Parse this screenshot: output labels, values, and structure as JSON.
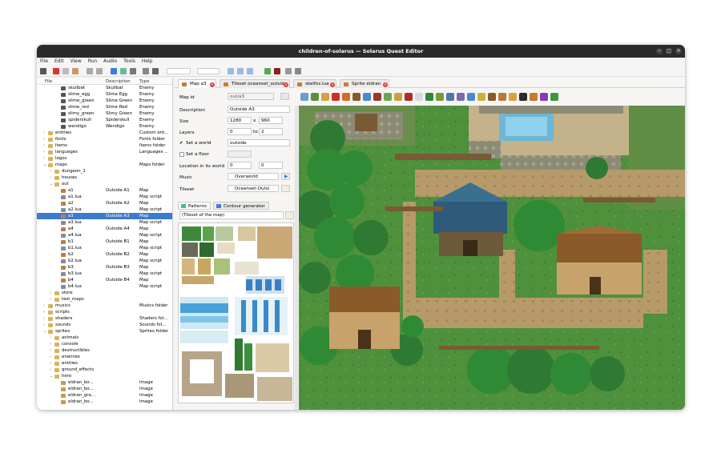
{
  "window": {
    "title": "children-of-solarus — Solarus Quest Editor"
  },
  "menu": [
    "File",
    "Edit",
    "View",
    "Run",
    "Audio",
    "Tools",
    "Help"
  ],
  "tree": {
    "headers": {
      "file": "File",
      "description": "Description",
      "type": "Type"
    },
    "rows": [
      {
        "name": "skullbat",
        "desc": "Skullbat",
        "type": "Enemy",
        "depth": 3,
        "kind": "sprite"
      },
      {
        "name": "slime_egg",
        "desc": "Slime Egg",
        "type": "Enemy",
        "depth": 3,
        "kind": "sprite"
      },
      {
        "name": "slime_green",
        "desc": "Slime Green",
        "type": "Enemy",
        "depth": 3,
        "kind": "sprite"
      },
      {
        "name": "slime_red",
        "desc": "Slime Red",
        "type": "Enemy",
        "depth": 3,
        "kind": "sprite"
      },
      {
        "name": "slimy_green",
        "desc": "Slimy Green",
        "type": "Enemy",
        "depth": 3,
        "kind": "sprite"
      },
      {
        "name": "spiderskull",
        "desc": "Spiderskull",
        "type": "Enemy",
        "depth": 3,
        "kind": "sprite"
      },
      {
        "name": "wendigo",
        "desc": "Wendigo",
        "type": "Enemy",
        "depth": 3,
        "kind": "sprite"
      },
      {
        "name": "entities",
        "desc": "",
        "type": "Custom ent...",
        "depth": 1,
        "kind": "folder",
        "arrow": "›"
      },
      {
        "name": "fonts",
        "desc": "",
        "type": "Fonts folder",
        "depth": 1,
        "kind": "folder",
        "arrow": "›"
      },
      {
        "name": "items",
        "desc": "",
        "type": "Items folder",
        "depth": 1,
        "kind": "folder",
        "arrow": "›"
      },
      {
        "name": "languages",
        "desc": "",
        "type": "Languages ...",
        "depth": 1,
        "kind": "folder",
        "arrow": "›"
      },
      {
        "name": "logos",
        "desc": "",
        "type": "",
        "depth": 1,
        "kind": "folder",
        "arrow": "›"
      },
      {
        "name": "maps",
        "desc": "",
        "type": "Maps folder",
        "depth": 1,
        "kind": "folder",
        "arrow": "⌄"
      },
      {
        "name": "dungeon_1",
        "desc": "",
        "type": "",
        "depth": 2,
        "kind": "folder",
        "arrow": "›"
      },
      {
        "name": "houses",
        "desc": "",
        "type": "",
        "depth": 2,
        "kind": "folder",
        "arrow": "›"
      },
      {
        "name": "out",
        "desc": "",
        "type": "",
        "depth": 2,
        "kind": "folder",
        "arrow": "⌄"
      },
      {
        "name": "a1",
        "desc": "Outside A1",
        "type": "Map",
        "depth": 3,
        "kind": "map"
      },
      {
        "name": "a1.lua",
        "desc": "",
        "type": "Map script",
        "depth": 3,
        "kind": "lua"
      },
      {
        "name": "a2",
        "desc": "Outside A2",
        "type": "Map",
        "depth": 3,
        "kind": "map"
      },
      {
        "name": "a2.lua",
        "desc": "",
        "type": "Map script",
        "depth": 3,
        "kind": "lua"
      },
      {
        "name": "a3",
        "desc": "Outside A3",
        "type": "Map",
        "depth": 3,
        "kind": "map",
        "sel": true
      },
      {
        "name": "a3.lua",
        "desc": "",
        "type": "Map script",
        "depth": 3,
        "kind": "lua"
      },
      {
        "name": "a4",
        "desc": "Outside A4",
        "type": "Map",
        "depth": 3,
        "kind": "map"
      },
      {
        "name": "a4.lua",
        "desc": "",
        "type": "Map script",
        "depth": 3,
        "kind": "lua"
      },
      {
        "name": "b1",
        "desc": "Outside B1",
        "type": "Map",
        "depth": 3,
        "kind": "map"
      },
      {
        "name": "b1.lua",
        "desc": "",
        "type": "Map script",
        "depth": 3,
        "kind": "lua"
      },
      {
        "name": "b2",
        "desc": "Outside B2",
        "type": "Map",
        "depth": 3,
        "kind": "map"
      },
      {
        "name": "b2.lua",
        "desc": "",
        "type": "Map script",
        "depth": 3,
        "kind": "lua"
      },
      {
        "name": "b3",
        "desc": "Outside B3",
        "type": "Map",
        "depth": 3,
        "kind": "map"
      },
      {
        "name": "b3.lua",
        "desc": "",
        "type": "Map script",
        "depth": 3,
        "kind": "lua"
      },
      {
        "name": "b4",
        "desc": "Outside B4",
        "type": "Map",
        "depth": 3,
        "kind": "map"
      },
      {
        "name": "b4.lua",
        "desc": "",
        "type": "Map script",
        "depth": 3,
        "kind": "lua"
      },
      {
        "name": "store",
        "desc": "",
        "type": "",
        "depth": 2,
        "kind": "folder",
        "arrow": "›"
      },
      {
        "name": "test_maps",
        "desc": "",
        "type": "",
        "depth": 2,
        "kind": "folder",
        "arrow": "›"
      },
      {
        "name": "musics",
        "desc": "",
        "type": "Musics folder",
        "depth": 1,
        "kind": "folder",
        "arrow": "›"
      },
      {
        "name": "scripts",
        "desc": "",
        "type": "",
        "depth": 1,
        "kind": "folder",
        "arrow": "›"
      },
      {
        "name": "shaders",
        "desc": "",
        "type": "Shaders fol...",
        "depth": 1,
        "kind": "folder",
        "arrow": "›"
      },
      {
        "name": "sounds",
        "desc": "",
        "type": "Sounds fol...",
        "depth": 1,
        "kind": "folder",
        "arrow": "›"
      },
      {
        "name": "sprites",
        "desc": "",
        "type": "Sprites folder",
        "depth": 1,
        "kind": "folder",
        "arrow": "⌄"
      },
      {
        "name": "animals",
        "desc": "",
        "type": "",
        "depth": 2,
        "kind": "folder",
        "arrow": "›"
      },
      {
        "name": "console",
        "desc": "",
        "type": "",
        "depth": 2,
        "kind": "folder",
        "arrow": "›"
      },
      {
        "name": "destructibles",
        "desc": "",
        "type": "",
        "depth": 2,
        "kind": "folder",
        "arrow": "›"
      },
      {
        "name": "enemies",
        "desc": "",
        "type": "",
        "depth": 2,
        "kind": "folder",
        "arrow": "›"
      },
      {
        "name": "entities",
        "desc": "",
        "type": "",
        "depth": 2,
        "kind": "folder",
        "arrow": "›"
      },
      {
        "name": "ground_effects",
        "desc": "",
        "type": "",
        "depth": 2,
        "kind": "folder",
        "arrow": "›"
      },
      {
        "name": "hero",
        "desc": "",
        "type": "",
        "depth": 2,
        "kind": "folder",
        "arrow": "⌄"
      },
      {
        "name": "eldran_bo...",
        "desc": "",
        "type": "Image",
        "depth": 3,
        "kind": "image"
      },
      {
        "name": "eldran_bo...",
        "desc": "",
        "type": "Image",
        "depth": 3,
        "kind": "image"
      },
      {
        "name": "eldran_gra...",
        "desc": "",
        "type": "Image",
        "depth": 3,
        "kind": "image"
      },
      {
        "name": "eldran_bo...",
        "desc": "",
        "type": "Image",
        "depth": 3,
        "kind": "image"
      }
    ]
  },
  "tabs": [
    {
      "label": "Map a3",
      "active": true
    },
    {
      "label": "Tileset oceanset_outside",
      "active": false
    },
    {
      "label": "skelfos.lua",
      "active": false
    },
    {
      "label": "Sprite eldran",
      "active": false
    }
  ],
  "properties": {
    "map_id_label": "Map id",
    "map_id": "out/a3",
    "description_label": "Description",
    "description": "Outside A3",
    "size_label": "Size",
    "size_w": "1280",
    "size_h": "960",
    "size_x": "x",
    "layers_label": "Layers",
    "layers_min": "0",
    "layers_max": "2",
    "layers_to": "to",
    "set_world_label": "Set a world",
    "world": "outside",
    "set_floor_label": "Set a floor",
    "location_label": "Location in its world",
    "loc_x": "0",
    "loc_y": "0",
    "music_label": "Music",
    "music": "Overworld",
    "tileset_label": "Tileset",
    "tileset": "Oceanset-Outsi"
  },
  "subtabs": {
    "patterns": "Patterns",
    "contour": "Contour generator"
  },
  "tileset_selector": "(Tileset of the map)"
}
